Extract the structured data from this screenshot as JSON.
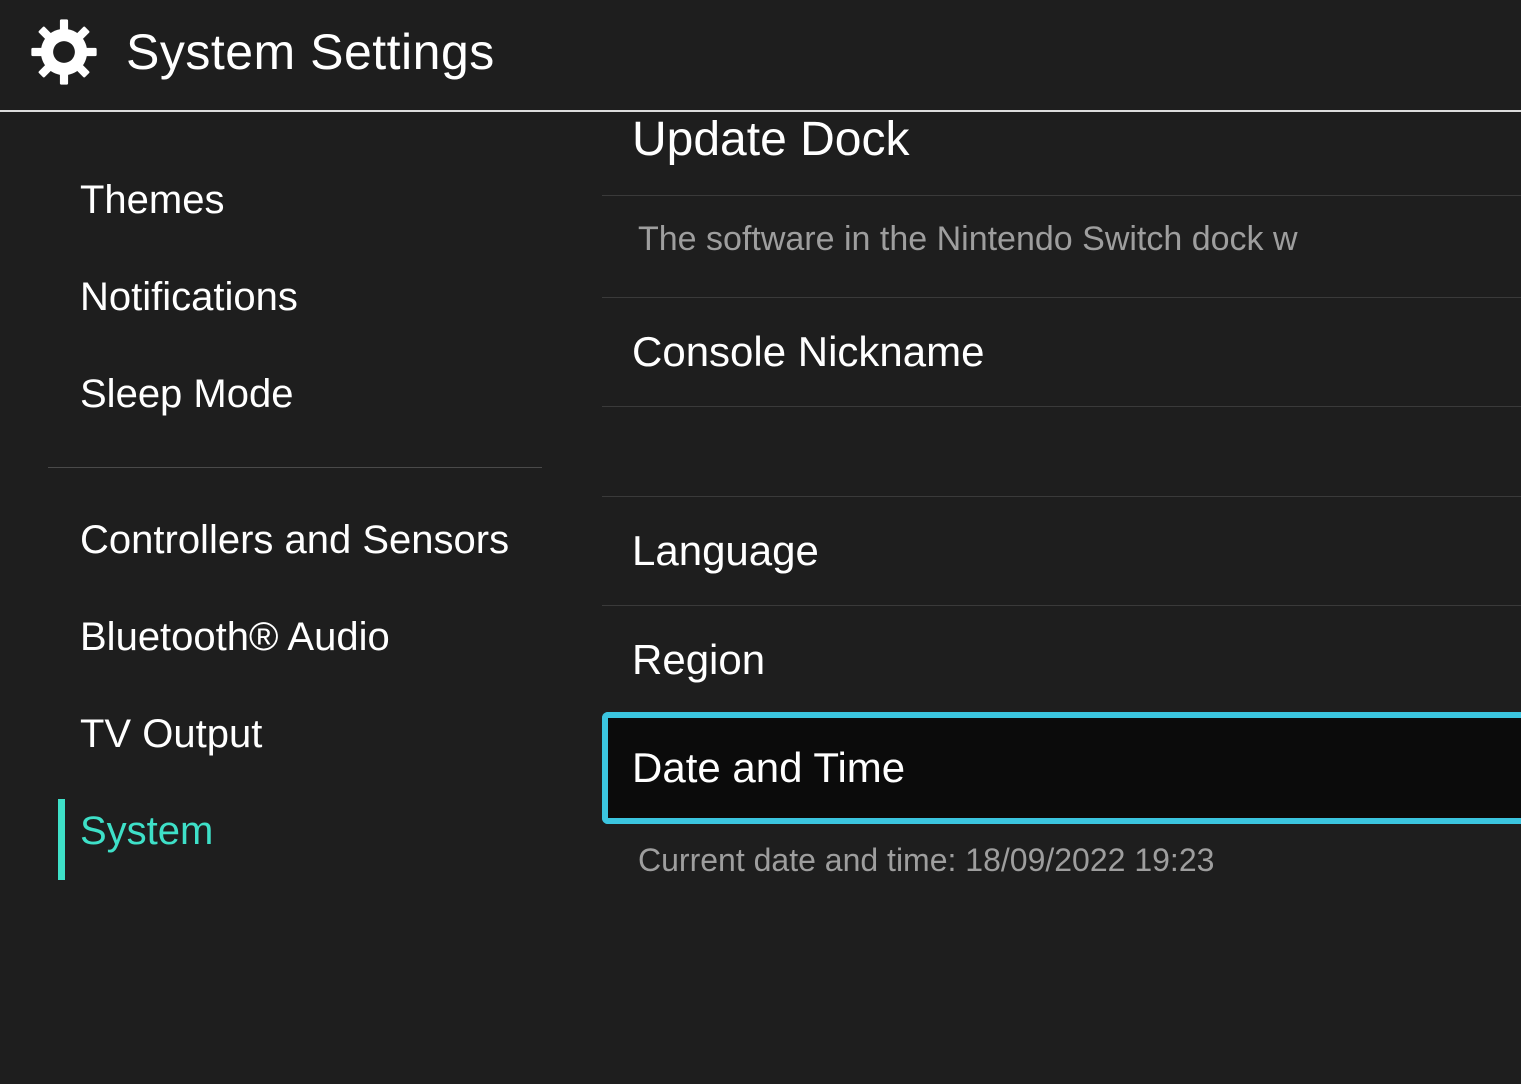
{
  "header": {
    "title": "System Settings"
  },
  "sidebar": {
    "items": [
      {
        "label": "Themes",
        "active": false
      },
      {
        "label": "Notifications",
        "active": false
      },
      {
        "label": "Sleep Mode",
        "active": false
      },
      {
        "label": "Controllers and Sensors",
        "active": false
      },
      {
        "label": "Bluetooth® Audio",
        "active": false
      },
      {
        "label": "TV Output",
        "active": false
      },
      {
        "label": "System",
        "active": true
      }
    ]
  },
  "main": {
    "update_dock_label": "Update Dock",
    "update_dock_desc": "The software in the Nintendo Switch dock w",
    "console_nickname_label": "Console Nickname",
    "language_label": "Language",
    "region_label": "Region",
    "date_time_label": "Date and Time",
    "date_time_sub": "Current date and time: 18/09/2022 19:23"
  }
}
